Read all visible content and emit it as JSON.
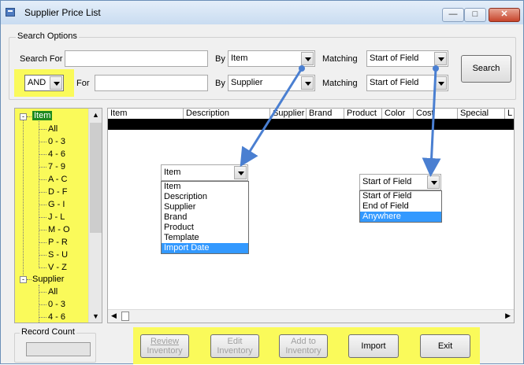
{
  "window": {
    "title": "Supplier Price List"
  },
  "search_options": {
    "group_label": "Search Options",
    "row1": {
      "label": "Search For",
      "by_label": "By",
      "by_value": "Item",
      "matching_label": "Matching",
      "matching_value": "Start of Field"
    },
    "row2": {
      "connector": "AND",
      "for_label": "For",
      "by_label": "By",
      "by_value": "Supplier",
      "matching_label": "Matching",
      "matching_value": "Start of Field"
    },
    "search_button": "Search"
  },
  "tree": {
    "item_root": "Item",
    "item_children": [
      "All",
      "0 - 3",
      "4 - 6",
      "7 - 9",
      "A - C",
      "D - F",
      "G - I",
      "J - L",
      "M - O",
      "P - R",
      "S - U",
      "V - Z"
    ],
    "supplier_root": "Supplier",
    "supplier_children": [
      "All",
      "0 - 3",
      "4 - 6"
    ]
  },
  "grid": {
    "columns": [
      "Item",
      "Description",
      "Supplier",
      "Brand",
      "Product",
      "Color",
      "Cost",
      "Special",
      "L"
    ]
  },
  "by_dropdown": {
    "selected": "Item",
    "options": [
      "Item",
      "Description",
      "Supplier",
      "Brand",
      "Product",
      "Template",
      "Import Date"
    ],
    "highlighted": "Import Date"
  },
  "matching_dropdown": {
    "selected": "Start of Field",
    "options": [
      "Start of Field",
      "End of Field",
      "Anywhere"
    ],
    "highlighted": "Anywhere"
  },
  "record_count": {
    "label": "Record Count"
  },
  "buttons": {
    "review": {
      "line1": "Review",
      "line2": "Inventory"
    },
    "edit": {
      "line1": "Edit",
      "line2": "Inventory"
    },
    "add": {
      "line1": "Add to",
      "line2": "Inventory"
    },
    "import": "Import",
    "exit": "Exit"
  },
  "colors": {
    "highlight": "#fafa5a",
    "arrow": "#4a7fd1",
    "tree_selected": "#1e8a1e",
    "list_selected": "#3399ff"
  }
}
